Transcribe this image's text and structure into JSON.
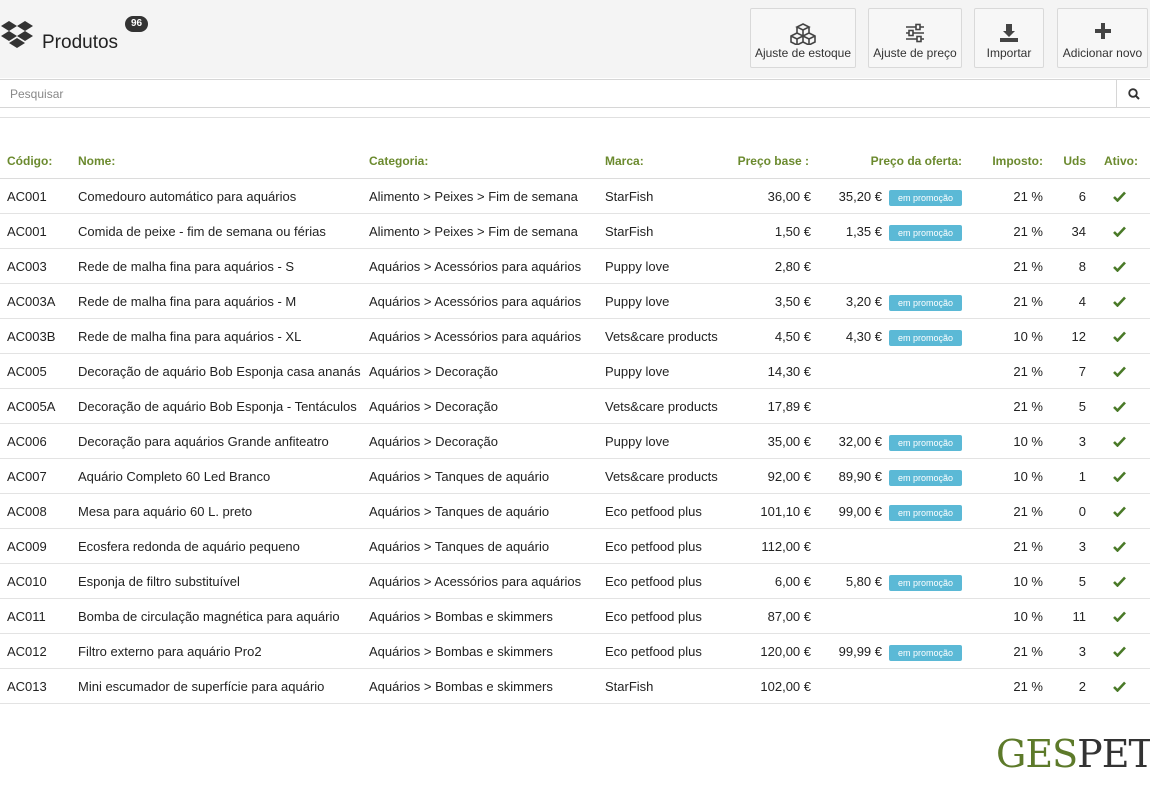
{
  "header": {
    "title": "Produtos",
    "count": "96",
    "buttons": [
      {
        "label": "Ajuste de estoque",
        "icon": "cubes-icon"
      },
      {
        "label": "Ajuste de preço",
        "icon": "sliders-icon"
      },
      {
        "label": "Importar",
        "icon": "download-icon"
      },
      {
        "label": "Adicionar novo",
        "icon": "plus-icon"
      }
    ]
  },
  "search": {
    "placeholder": "Pesquisar",
    "value": ""
  },
  "table": {
    "headers": {
      "code": "Código:",
      "name": "Nome:",
      "category": "Categoria:",
      "brand": "Marca:",
      "base_price": "Preço base :",
      "offer_price": "Preço da oferta:",
      "tax": "Imposto:",
      "units": "Uds",
      "active": "Ativo:"
    },
    "promo_label": "em promoção",
    "rows": [
      {
        "code": "AC001",
        "name": "Comedouro automático para aquários",
        "category": "Alimento > Peixes > Fim de semana",
        "brand": "StarFish",
        "base_price": "36,00 €",
        "offer_price": "35,20 €",
        "promo": true,
        "tax": "21 %",
        "units": "6",
        "active": true
      },
      {
        "code": "AC001",
        "name": "Comida de peixe - fim de semana ou férias",
        "category": "Alimento > Peixes > Fim de semana",
        "brand": "StarFish",
        "base_price": "1,50 €",
        "offer_price": "1,35 €",
        "promo": true,
        "tax": "21 %",
        "units": "34",
        "active": true
      },
      {
        "code": "AC003",
        "name": "Rede de malha fina para aquários - S",
        "category": "Aquários > Acessórios para aquários",
        "brand": "Puppy love",
        "base_price": "2,80 €",
        "offer_price": "",
        "promo": false,
        "tax": "21 %",
        "units": "8",
        "active": true
      },
      {
        "code": "AC003A",
        "name": "Rede de malha fina para aquários - M",
        "category": "Aquários > Acessórios para aquários",
        "brand": "Puppy love",
        "base_price": "3,50 €",
        "offer_price": "3,20 €",
        "promo": true,
        "tax": "21 %",
        "units": "4",
        "active": true
      },
      {
        "code": "AC003B",
        "name": "Rede de malha fina para aquários - XL",
        "category": "Aquários > Acessórios para aquários",
        "brand": "Vets&care products",
        "base_price": "4,50 €",
        "offer_price": "4,30 €",
        "promo": true,
        "tax": "10 %",
        "units": "12",
        "active": true
      },
      {
        "code": "AC005",
        "name": "Decoração de aquário Bob Esponja casa ananás",
        "category": "Aquários > Decoração",
        "brand": "Puppy love",
        "base_price": "14,30 €",
        "offer_price": "",
        "promo": false,
        "tax": "21 %",
        "units": "7",
        "active": true
      },
      {
        "code": "AC005A",
        "name": "Decoração de aquário Bob Esponja -  Tentáculos",
        "category": "Aquários > Decoração",
        "brand": "Vets&care products",
        "base_price": "17,89 €",
        "offer_price": "",
        "promo": false,
        "tax": "21 %",
        "units": "5",
        "active": true
      },
      {
        "code": "AC006",
        "name": "Decoração para aquários Grande anfiteatro",
        "category": "Aquários > Decoração",
        "brand": "Puppy love",
        "base_price": "35,00 €",
        "offer_price": "32,00 €",
        "promo": true,
        "tax": "10 %",
        "units": "3",
        "active": true
      },
      {
        "code": "AC007",
        "name": "Aquário Completo 60 Led Branco",
        "category": "Aquários > Tanques de aquário",
        "brand": "Vets&care products",
        "base_price": "92,00 €",
        "offer_price": "89,90 €",
        "promo": true,
        "tax": "10 %",
        "units": "1",
        "active": true
      },
      {
        "code": "AC008",
        "name": "Mesa para aquário 60 L. preto",
        "category": "Aquários > Tanques de aquário",
        "brand": "Eco petfood plus",
        "base_price": "101,10 €",
        "offer_price": "99,00 €",
        "promo": true,
        "tax": "21 %",
        "units": "0",
        "active": true
      },
      {
        "code": "AC009",
        "name": "Ecosfera redonda de aquário pequeno",
        "category": "Aquários > Tanques de aquário",
        "brand": "Eco petfood plus",
        "base_price": "112,00 €",
        "offer_price": "",
        "promo": false,
        "tax": "21 %",
        "units": "3",
        "active": true
      },
      {
        "code": "AC010",
        "name": "Esponja de filtro substituível",
        "category": "Aquários > Acessórios para aquários",
        "brand": "Eco petfood plus",
        "base_price": "6,00 €",
        "offer_price": "5,80 €",
        "promo": true,
        "tax": "10 %",
        "units": "5",
        "active": true
      },
      {
        "code": "AC011",
        "name": "Bomba de circulação magnética para aquário",
        "category": "Aquários > Bombas e skimmers",
        "brand": "Eco petfood plus",
        "base_price": "87,00 €",
        "offer_price": "",
        "promo": false,
        "tax": "10 %",
        "units": "11",
        "active": true
      },
      {
        "code": "AC012",
        "name": "Filtro externo para aquário Pro2",
        "category": "Aquários > Bombas e skimmers",
        "brand": "Eco petfood plus",
        "base_price": "120,00 €",
        "offer_price": "99,99 €",
        "promo": true,
        "tax": "21 %",
        "units": "3",
        "active": true
      },
      {
        "code": "AC013",
        "name": "Mini escumador de superfície para aquário",
        "category": "Aquários > Bombas e skimmers",
        "brand": "StarFish",
        "base_price": "102,00 €",
        "offer_price": "",
        "promo": false,
        "tax": "21 %",
        "units": "2",
        "active": true
      }
    ]
  },
  "brand_logo": {
    "part1": "GES",
    "part2": "PET"
  },
  "colors": {
    "accent": "#6b8a2e",
    "promo": "#5bb9d6",
    "check": "#4a7a28"
  }
}
